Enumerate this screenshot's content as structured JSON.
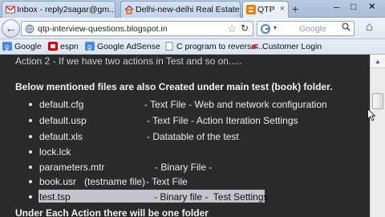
{
  "tabs": [
    {
      "label": "Inbox - reply2sagar@gm...",
      "icon": "gmail-icon",
      "close": "×"
    },
    {
      "label": "Delhi-new-delhi Real Estate",
      "icon": "house-icon",
      "close": "×"
    },
    {
      "label": "QTP",
      "icon": "blogger-icon",
      "close": "×",
      "active": true
    }
  ],
  "tab_new": "+",
  "window_controls": {
    "minimize": "–",
    "maximize": "□",
    "close": "×"
  },
  "navbar": {
    "back": "←",
    "url": "qtp-interview-questions.blogspot.in",
    "star": "☆",
    "reload": "↻",
    "search_placeholder": "Google",
    "search_drop": "▾",
    "search_icon": "🔍",
    "home": "⌂"
  },
  "bookmarks": [
    {
      "label": "Google",
      "icon": "google-icon"
    },
    {
      "label": "espn",
      "icon": "espn-icon"
    },
    {
      "label": "Google AdSense",
      "icon": "adsense-icon"
    },
    {
      "label": "C program to reverse ...",
      "icon": "page-icon"
    },
    {
      "label": "Customer Login",
      "icon": "customer-login-icon"
    }
  ],
  "content": {
    "top_line": "Action 2 - If we have two actions in Test and so on.....",
    "heading": "Below mentioned files are also Created under main test (book) folder.",
    "files": [
      {
        "name": "default.cfg",
        "desc": "- Text File - Web and network configuration"
      },
      {
        "name": "default.usp",
        "desc": "- Text File - Action Iteration Settings"
      },
      {
        "name": "default.xls",
        "desc": "- Datatable of the test"
      },
      {
        "name": "lock.lck",
        "desc": ""
      },
      {
        "name": "parameters.mtr",
        "desc": "- Binary File -"
      },
      {
        "name": "book.usr   (testname file)",
        "desc": "- Text File"
      },
      {
        "name": "test.tsp",
        "desc": "- Binary file -  Test Settings",
        "selected": true
      }
    ],
    "footer": "Under Each Action there will be one folder"
  },
  "scrollbar": {
    "up": "▲"
  },
  "colors": {
    "page_bg": "#2b2b2b",
    "text": "#ececec",
    "selection": "#c4c4cc",
    "chrome": "#dfe7f2"
  }
}
